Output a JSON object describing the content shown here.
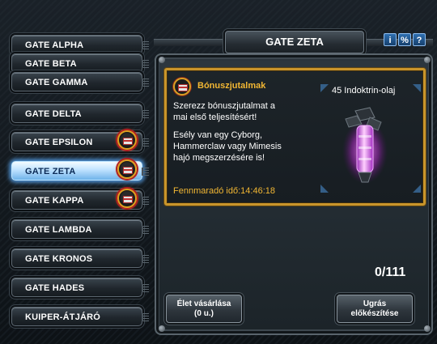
{
  "header": {
    "title": "GATE ZETA",
    "icons": [
      {
        "name": "info-icon",
        "glyph": "i"
      },
      {
        "name": "percent-icon",
        "glyph": "%"
      },
      {
        "name": "help-icon",
        "glyph": "?"
      }
    ]
  },
  "gates": [
    {
      "label": "GATE ALPHA",
      "active": false,
      "bonus": false
    },
    {
      "label": "GATE BETA",
      "active": false,
      "bonus": false
    },
    {
      "label": "GATE GAMMA",
      "active": false,
      "bonus": false
    },
    {
      "label": "GATE DELTA",
      "active": false,
      "bonus": false
    },
    {
      "label": "GATE EPSILON",
      "active": false,
      "bonus": true
    },
    {
      "label": "GATE ZETA",
      "active": true,
      "bonus": true
    },
    {
      "label": "GATE KAPPA",
      "active": false,
      "bonus": true
    },
    {
      "label": "GATE LAMBDA",
      "active": false,
      "bonus": false
    },
    {
      "label": "GATE KRONOS",
      "active": false,
      "bonus": false
    },
    {
      "label": "GATE HADES",
      "active": false,
      "bonus": false
    },
    {
      "label": "KUIPER-ÁTJÁRÓ",
      "active": false,
      "bonus": false
    }
  ],
  "bonus": {
    "title": "Bónuszjutalmak",
    "desc_line1": "Szerezz bónuszjutalmat a",
    "desc_line2": "mai első teljesítésért!",
    "chance_line1": "Esély van egy Cyborg,",
    "chance_line2": "Hammerclaw vagy Mimesis",
    "chance_line3": "hajó megszerzésére is!",
    "reward": "45 Indoktrin-olaj",
    "timer": "Fennmaradó idő:14:46:18",
    "icon": "treasure-chest-icon",
    "item_icon": "oil-capsule-icon"
  },
  "progress": {
    "text": "0/111"
  },
  "actions": {
    "buy_life_line1": "Élet vásárlása",
    "buy_life_line2": "(0 u.)",
    "jump_line1": "Ugrás",
    "jump_line2": "előkészítése"
  },
  "colors": {
    "accent_gold": "#f2b733",
    "active_blue": "#6fb3ea",
    "item_glow": "#e040ff"
  }
}
